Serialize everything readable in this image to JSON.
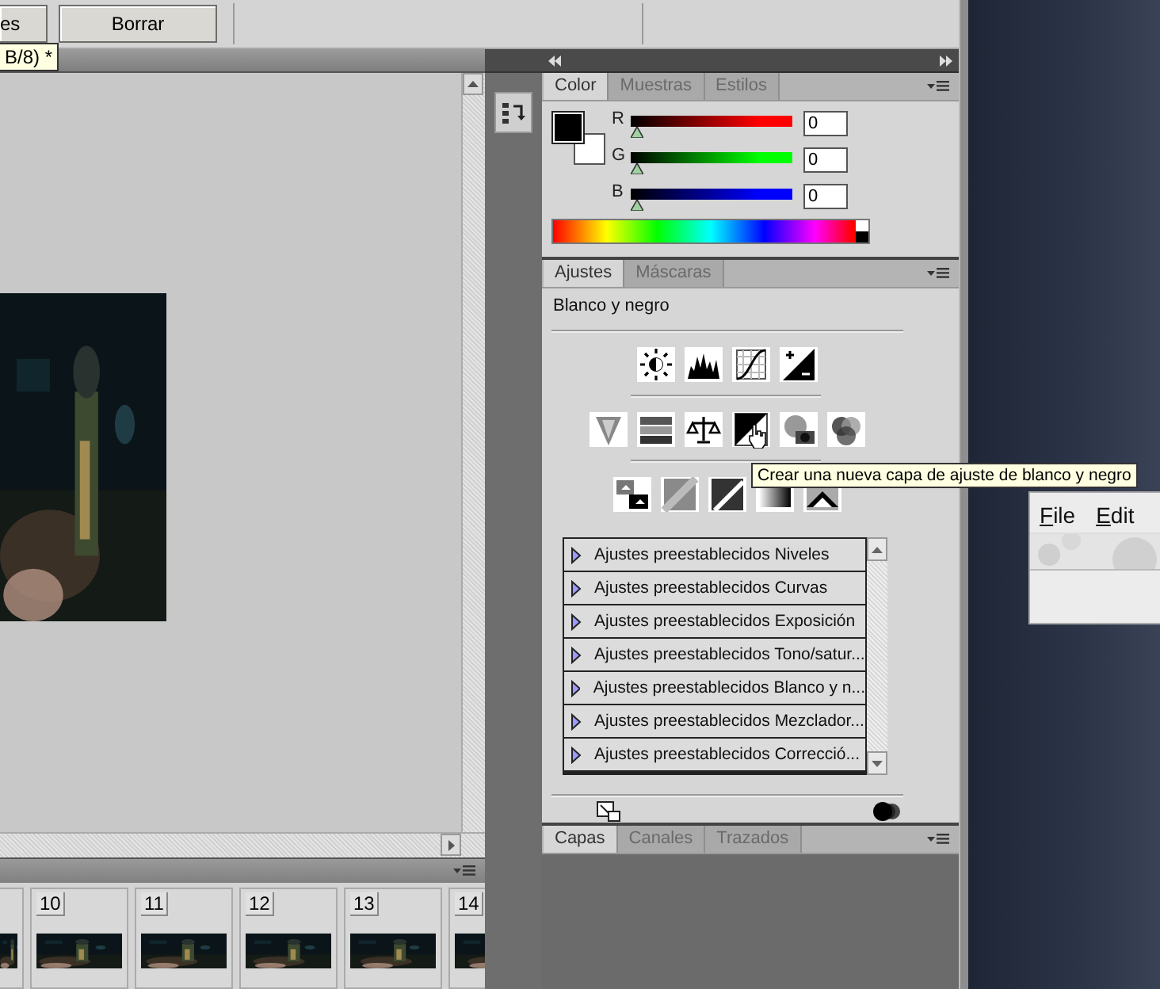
{
  "options_bar": {
    "buttons": [
      "es",
      "Borrar"
    ]
  },
  "document": {
    "tab_tooltip": "B/8) *"
  },
  "animation_panel": {
    "frames": [
      {
        "kind": "partial"
      },
      {
        "number": "10"
      },
      {
        "number": "11"
      },
      {
        "number": "12"
      },
      {
        "number": "13"
      },
      {
        "number": "14"
      }
    ]
  },
  "color_panel": {
    "tabs": [
      {
        "label": "Color",
        "selected": true
      },
      {
        "label": "Muestras",
        "selected": false
      },
      {
        "label": "Estilos",
        "selected": false
      }
    ],
    "channels": [
      {
        "name": "R",
        "color": "#ff0000",
        "level": 0,
        "value": "0"
      },
      {
        "name": "G",
        "color": "#00ff00",
        "level": 0,
        "value": "0"
      },
      {
        "name": "B",
        "color": "#0000ff",
        "level": 0,
        "value": "0"
      }
    ]
  },
  "adjustments_panel": {
    "tabs": [
      {
        "label": "Ajustes",
        "selected": true
      },
      {
        "label": "Máscaras",
        "selected": false
      }
    ],
    "title": "Blanco y negro",
    "icon_rows": [
      [
        {
          "kind": "brightness",
          "hovered": false
        },
        {
          "kind": "levels",
          "hovered": false
        },
        {
          "kind": "curves",
          "hovered": false
        },
        {
          "kind": "exposure",
          "hovered": false
        }
      ],
      [
        {
          "kind": "vibrance",
          "hovered": false
        },
        {
          "kind": "hue",
          "hovered": false
        },
        {
          "kind": "balance",
          "hovered": false
        },
        {
          "kind": "blackwhite",
          "hovered": true
        },
        {
          "kind": "photofilter",
          "hovered": false
        },
        {
          "kind": "mixer",
          "hovered": false
        }
      ],
      [
        {
          "kind": "invert",
          "hovered": false
        },
        {
          "kind": "posterize",
          "hovered": false
        },
        {
          "kind": "threshold",
          "hovered": false
        },
        {
          "kind": "gradient",
          "hovered": false
        },
        {
          "kind": "selective",
          "hovered": false
        }
      ]
    ],
    "tooltip": "Crear una nueva capa de ajuste de blanco y negro",
    "presets": [
      "Ajustes preestablecidos Niveles",
      "Ajustes preestablecidos Curvas",
      "Ajustes preestablecidos Exposición",
      "Ajustes preestablecidos Tono/satur...",
      "Ajustes preestablecidos Blanco y n...",
      "Ajustes preestablecidos Mezclador...",
      "Ajustes preestablecidos Correcció..."
    ]
  },
  "layers_panel": {
    "tabs": [
      {
        "label": "Capas",
        "selected": true
      },
      {
        "label": "Canales",
        "selected": false
      },
      {
        "label": "Trazados",
        "selected": false
      }
    ]
  },
  "desktop_window": {
    "menu": [
      "File",
      "Edit"
    ]
  }
}
